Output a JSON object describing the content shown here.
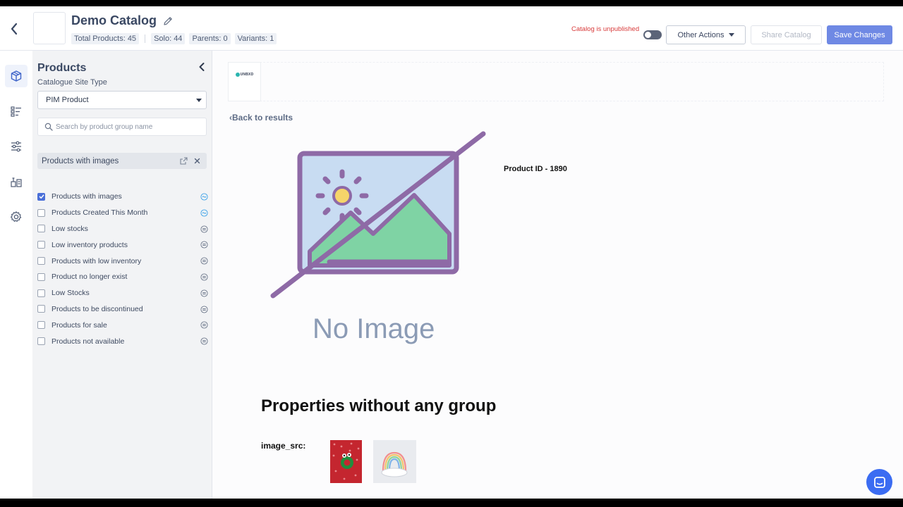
{
  "header": {
    "title": "Demo Catalog",
    "stats": [
      "Total Products: 45",
      "Solo: 44",
      "Parents: 0",
      "Variants: 1"
    ],
    "unpublished_text": "Catalog is unpublished",
    "other_actions_label": "Other Actions",
    "share_label": "Share Catalog",
    "save_label": "Save Changes"
  },
  "rail": {
    "icons": [
      "box-icon",
      "checklist-icon",
      "sliders-icon",
      "tools-icon",
      "gear-icon"
    ]
  },
  "sidebar": {
    "title": "Products",
    "site_type_label": "Catalogue Site Type",
    "site_type_value": "PIM Product",
    "search_placeholder": "Search by product group name",
    "active_filter": "Products with images",
    "filters": [
      {
        "label": "Products with images",
        "checked": true
      },
      {
        "label": "Products Created This Month",
        "checked": false
      },
      {
        "label": "Low stocks",
        "checked": false
      },
      {
        "label": "Low inventory products",
        "checked": false
      },
      {
        "label": "Products with low inventory",
        "checked": false
      },
      {
        "label": "Product no longer exist",
        "checked": false
      },
      {
        "label": "Low Stocks",
        "checked": false
      },
      {
        "label": "Products to be discontinued",
        "checked": false
      },
      {
        "label": "Products for sale",
        "checked": false
      },
      {
        "label": "Products not available",
        "checked": false
      }
    ]
  },
  "main": {
    "brand_logo_text": "UNBXD",
    "back_label": "Back to results",
    "no_image_text": "No Image",
    "product_id": "Product ID - 1890",
    "section_title": "Properties without any group",
    "property_label": "image_src:"
  },
  "colors": {
    "accent": "#6f89e4",
    "danger": "#d83b3b",
    "checkbox": "#4a6fd8",
    "chat": "#3b6cf2"
  }
}
